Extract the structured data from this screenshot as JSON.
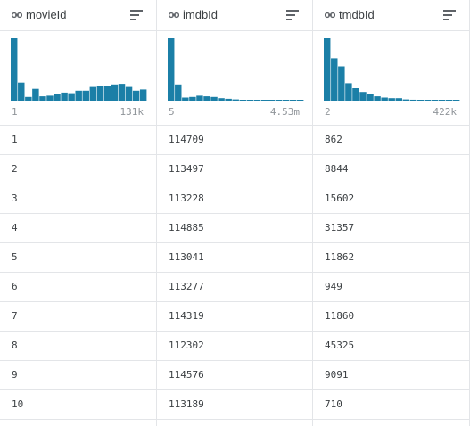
{
  "columns": [
    {
      "name": "movieId",
      "icon": "key-icon",
      "range_min": "1",
      "range_max": "131k",
      "histogram": [
        100,
        29,
        6,
        19,
        7,
        8,
        11,
        13,
        12,
        16,
        16,
        22,
        24,
        24,
        26,
        27,
        22,
        16,
        18
      ],
      "values": [
        "1",
        "2",
        "3",
        "4",
        "5",
        "6",
        "7",
        "8",
        "9",
        "10"
      ]
    },
    {
      "name": "imdbId",
      "icon": "key-icon",
      "range_min": "5",
      "range_max": "4.53m",
      "histogram": [
        100,
        26,
        5,
        6,
        8,
        7,
        6,
        4,
        3,
        2,
        1,
        1,
        0.5,
        0.3,
        0.3,
        0.2,
        0.2,
        0.2,
        0.2
      ],
      "values": [
        "114709",
        "113497",
        "113228",
        "114885",
        "113041",
        "113277",
        "114319",
        "112302",
        "114576",
        "113189"
      ]
    },
    {
      "name": "tmdbId",
      "icon": "key-icon",
      "range_min": "2",
      "range_max": "422k",
      "histogram": [
        100,
        68,
        55,
        28,
        20,
        14,
        10,
        7,
        5,
        4,
        4,
        2,
        1.5,
        1,
        0.7,
        0.5,
        0.3,
        0.2,
        0.2
      ],
      "values": [
        "862",
        "8844",
        "15602",
        "31357",
        "11862",
        "949",
        "11860",
        "45325",
        "9091",
        "710"
      ]
    }
  ],
  "colors": {
    "bar": "#1b7fa7",
    "grid": "#e3e5e8",
    "text": "#3c4043",
    "muted": "#8f9499"
  }
}
